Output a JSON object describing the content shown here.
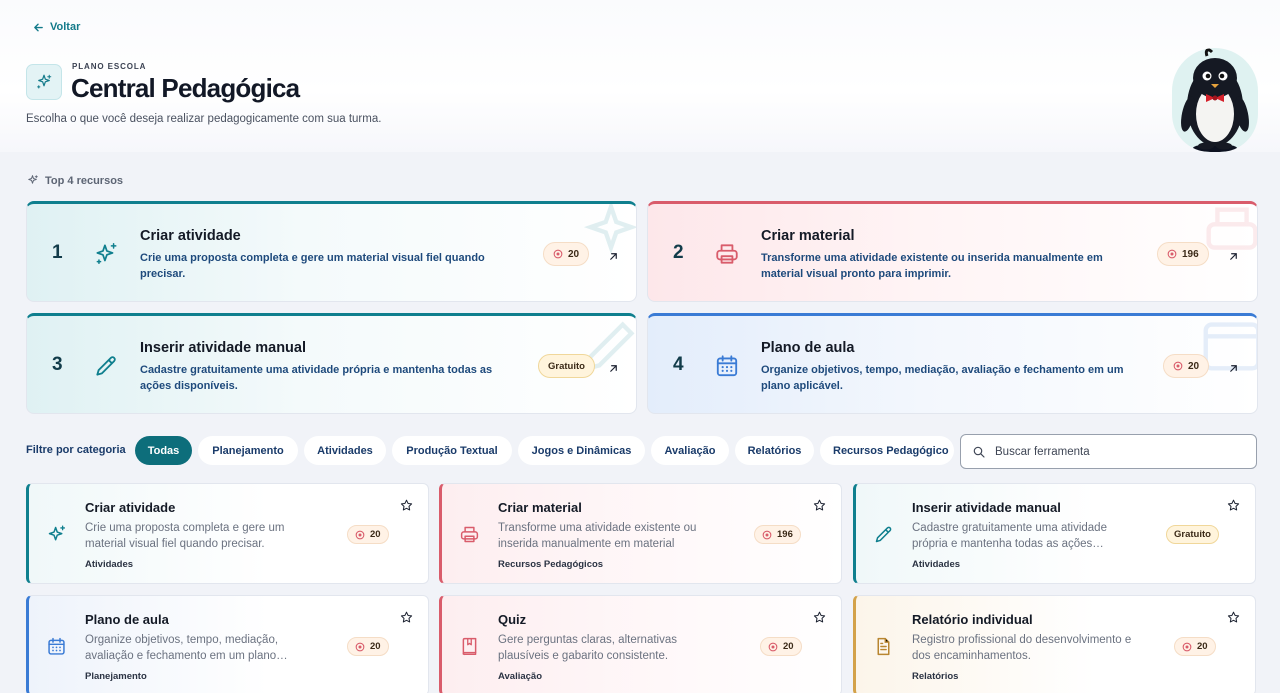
{
  "nav": {
    "back_label": "Voltar"
  },
  "header": {
    "eyebrow": "PLANO ESCOLA",
    "title": "Central Pedagógica",
    "subtitle": "Escolha o que você deseja realizar pedagogicamente com sua turma."
  },
  "top": {
    "label": "Top 4 recursos",
    "cards": [
      {
        "rank": "1",
        "title": "Criar atividade",
        "desc": "Crie uma proposta completa e gere um material visual fiel quando precisar.",
        "badge": "20",
        "icon": "sparkles-icon",
        "accent": "#0f7f8e"
      },
      {
        "rank": "2",
        "title": "Criar material",
        "desc": "Transforme uma atividade existente ou inserida manualmente em material visual pronto para imprimir.",
        "badge": "196",
        "icon": "printer-icon",
        "accent": "#d95c6b"
      },
      {
        "rank": "3",
        "title": "Inserir atividade manual",
        "desc": "Cadastre gratuitamente uma atividade própria e mantenha todas as ações disponíveis.",
        "badge": "Gratuito",
        "icon": "pencil-icon",
        "accent": "#0f7f8e"
      },
      {
        "rank": "4",
        "title": "Plano de aula",
        "desc": "Organize objetivos, tempo, mediação, avaliação e fechamento em um plano aplicável.",
        "badge": "20",
        "icon": "calendar-icon",
        "accent": "#3a7bd5"
      }
    ]
  },
  "filters": {
    "label": "Filtre por categoria",
    "chips": [
      "Todas",
      "Planejamento",
      "Atividades",
      "Produção Textual",
      "Jogos e Dinâmicas",
      "Avaliação",
      "Relatórios",
      "Recursos Pedagógico"
    ],
    "active": "Todas",
    "search_placeholder": "Buscar ferramenta"
  },
  "tools": [
    {
      "title": "Criar atividade",
      "desc": "Crie uma proposta completa e gere um material visual fiel quando precisar.",
      "category": "Atividades",
      "badge": "20",
      "icon": "sparkles-icon"
    },
    {
      "title": "Criar material",
      "desc": "Transforme uma atividade existente ou inserida manualmente em material visual…",
      "category": "Recursos Pedagógicos",
      "badge": "196",
      "icon": "printer-icon"
    },
    {
      "title": "Inserir atividade manual",
      "desc": "Cadastre gratuitamente uma atividade própria e mantenha todas as ações…",
      "category": "Atividades",
      "badge": "Gratuito",
      "icon": "pencil-icon"
    },
    {
      "title": "Plano de aula",
      "desc": "Organize objetivos, tempo, mediação, avaliação e fechamento em um plano…",
      "category": "Planejamento",
      "badge": "20",
      "icon": "calendar-icon"
    },
    {
      "title": "Quiz",
      "desc": "Gere perguntas claras, alternativas plausíveis e gabarito consistente.",
      "category": "Avaliação",
      "badge": "20",
      "icon": "book-icon"
    },
    {
      "title": "Relatório individual",
      "desc": "Registro profissional do desenvolvimento e dos encaminhamentos.",
      "category": "Relatórios",
      "badge": "20",
      "icon": "document-icon"
    }
  ],
  "colors": {
    "teal": "#0f7f8e",
    "red": "#d95c6b",
    "blue": "#3a7bd5",
    "gold": "#d3a24a",
    "active_chip": "#0d6e7b"
  }
}
